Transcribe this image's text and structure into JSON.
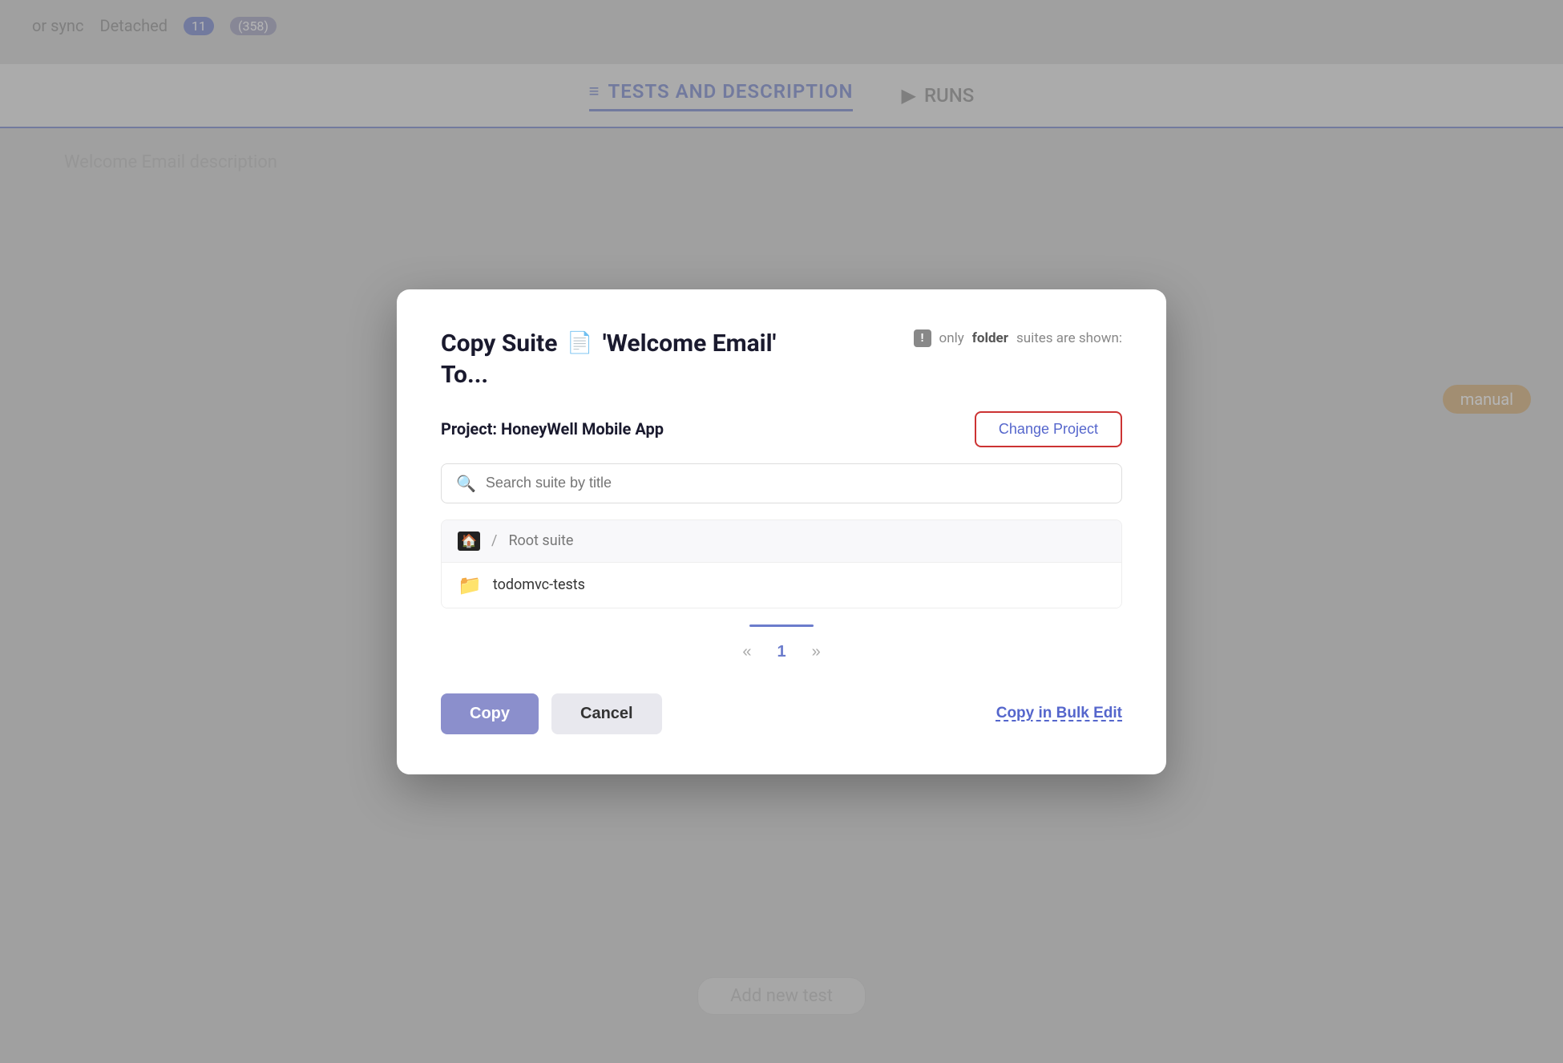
{
  "background": {
    "top_left_text": "or sync",
    "detached_label": "Detached",
    "detached_count": "11",
    "other_badge": "(358)",
    "tab_active": "TESTS AND DESCRIPTION",
    "tab_inactive": "RUNS",
    "description_text": "Welcome Email description",
    "manual_badge": "manual",
    "add_new_text": "Add new test"
  },
  "modal": {
    "title_line1": "Copy Suite",
    "title_suite_name": "'Welcome Email'",
    "title_line2": "To...",
    "info_text": "only",
    "info_bold": "folder",
    "info_suffix": "suites are shown:",
    "project_label": "Project: HoneyWell Mobile App",
    "change_project_label": "Change Project",
    "search_placeholder": "Search suite by title",
    "suites": [
      {
        "id": "root",
        "icon": "folder-home",
        "prefix": "/",
        "name": "Root suite",
        "is_root": true
      },
      {
        "id": "todomvc",
        "icon": "folder",
        "name": "todomvc-tests",
        "is_root": false
      }
    ],
    "pagination": {
      "prev_label": "«",
      "current_page": "1",
      "next_label": "»"
    },
    "copy_button": "Copy",
    "cancel_button": "Cancel",
    "bulk_edit_button": "Copy in Bulk Edit"
  }
}
